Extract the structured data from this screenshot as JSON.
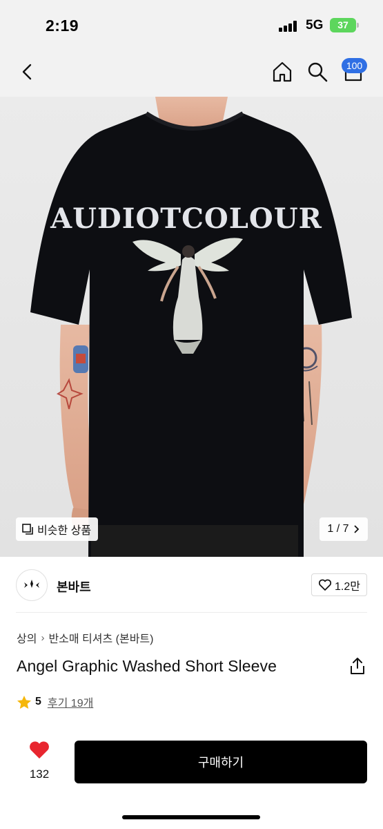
{
  "status_bar": {
    "time": "2:19",
    "network": "5G",
    "battery": "37"
  },
  "nav": {
    "cart_count": "100",
    "icons": [
      "back-icon",
      "home-icon",
      "search-icon",
      "cart-icon"
    ]
  },
  "gallery": {
    "similar_label": "비슷한 상품",
    "pager": "1 / 7",
    "graphic_text": "AUDIOTCOLOUR"
  },
  "brand": {
    "name": "본바트",
    "like_count": "1.2만"
  },
  "breadcrumb": {
    "category": "상의",
    "subcategory": "반소매 티셔츠 (본바트)"
  },
  "product": {
    "title": "Angel Graphic Washed Short Sleeve",
    "rating": "5",
    "reviews": "후기 19개"
  },
  "bottom_bar": {
    "wish_count": "132",
    "buy_label": "구매하기"
  },
  "colors": {
    "accent": "#2f6fe4",
    "battery": "#5dd65d",
    "heart": "#e8262f",
    "star": "#f5b70a"
  }
}
